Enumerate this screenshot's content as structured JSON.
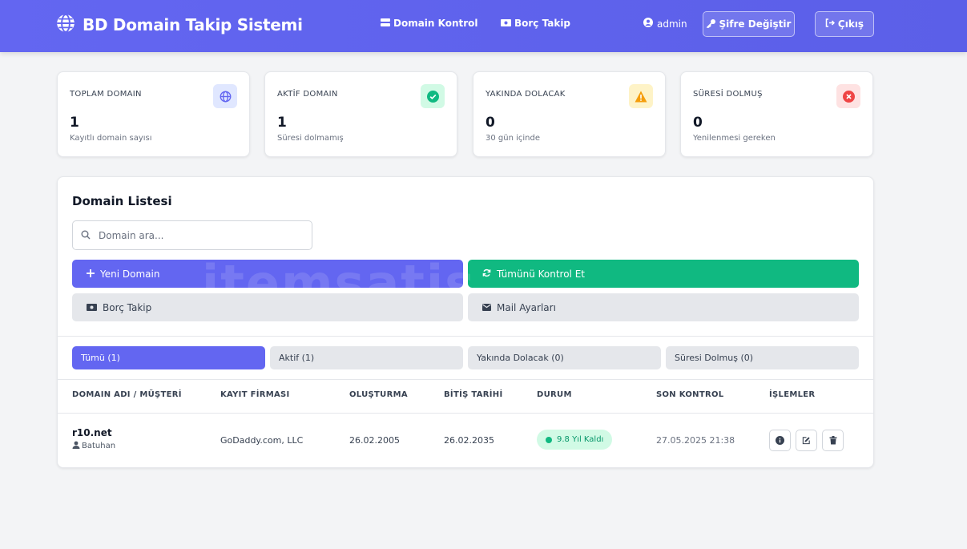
{
  "header": {
    "brand_title": "BD Domain Takip Sistemi",
    "nav": [
      {
        "label": "Domain Kontrol",
        "icon": "server-icon"
      },
      {
        "label": "Borç Takip",
        "icon": "money-bill-icon"
      }
    ],
    "user": {
      "name": "admin",
      "icon": "user-circle-icon"
    },
    "change_password_label": "Şifre Değiştir",
    "logout_label": "Çıkış"
  },
  "stats": [
    {
      "label": "TOPLAM DOMAIN",
      "value": "1",
      "sub": "Kayıtlı domain sayısı",
      "icon": "globe-icon",
      "color": "#6366f1"
    },
    {
      "label": "AKTİF DOMAIN",
      "value": "1",
      "sub": "Süresi dolmamış",
      "icon": "check-circle-icon",
      "color": "#10b981"
    },
    {
      "label": "YAKINDA DOLACAK",
      "value": "0",
      "sub": "30 gün içinde",
      "icon": "warning-icon",
      "color": "#f59e0b"
    },
    {
      "label": "SÜRESİ DOLMUŞ",
      "value": "0",
      "sub": "Yenilenmesi gereken",
      "icon": "times-circle-icon",
      "color": "#ef4444"
    }
  ],
  "panel": {
    "title": "Domain Listesi",
    "search_placeholder": "Domain ara...",
    "buttons": {
      "new_domain": "Yeni Domain",
      "check_all": "Tümünü Kontrol Et",
      "debt_tracking": "Borç Takip",
      "mail_settings": "Mail Ayarları"
    },
    "watermark": "itemsatis",
    "tabs": [
      {
        "label": "Tümü (1)",
        "active": true
      },
      {
        "label": "Aktif (1)",
        "active": false
      },
      {
        "label": "Yakında Dolacak (0)",
        "active": false
      },
      {
        "label": "Süresi Dolmuş (0)",
        "active": false
      }
    ],
    "table": {
      "headers": [
        "DOMAIN ADI / MÜŞTERİ",
        "KAYIT FİRMASI",
        "OLUŞTURMA",
        "BİTİŞ TARİHİ",
        "DURUM",
        "SON KONTROL",
        "İŞLEMLER"
      ],
      "rows": [
        {
          "domain": "r10.net",
          "customer": "Batuhan",
          "registrar": "GoDaddy.com, LLC",
          "created": "26.02.2005",
          "expires": "26.02.2035",
          "status": "9.8 Yıl Kaldı",
          "last_check": "27.05.2025 21:38",
          "actions": [
            "info-icon",
            "edit-icon",
            "trash-icon"
          ]
        }
      ]
    }
  },
  "colors": {
    "primary": "#6366f1",
    "success": "#10b981",
    "warning": "#f59e0b",
    "danger": "#ef4444"
  }
}
